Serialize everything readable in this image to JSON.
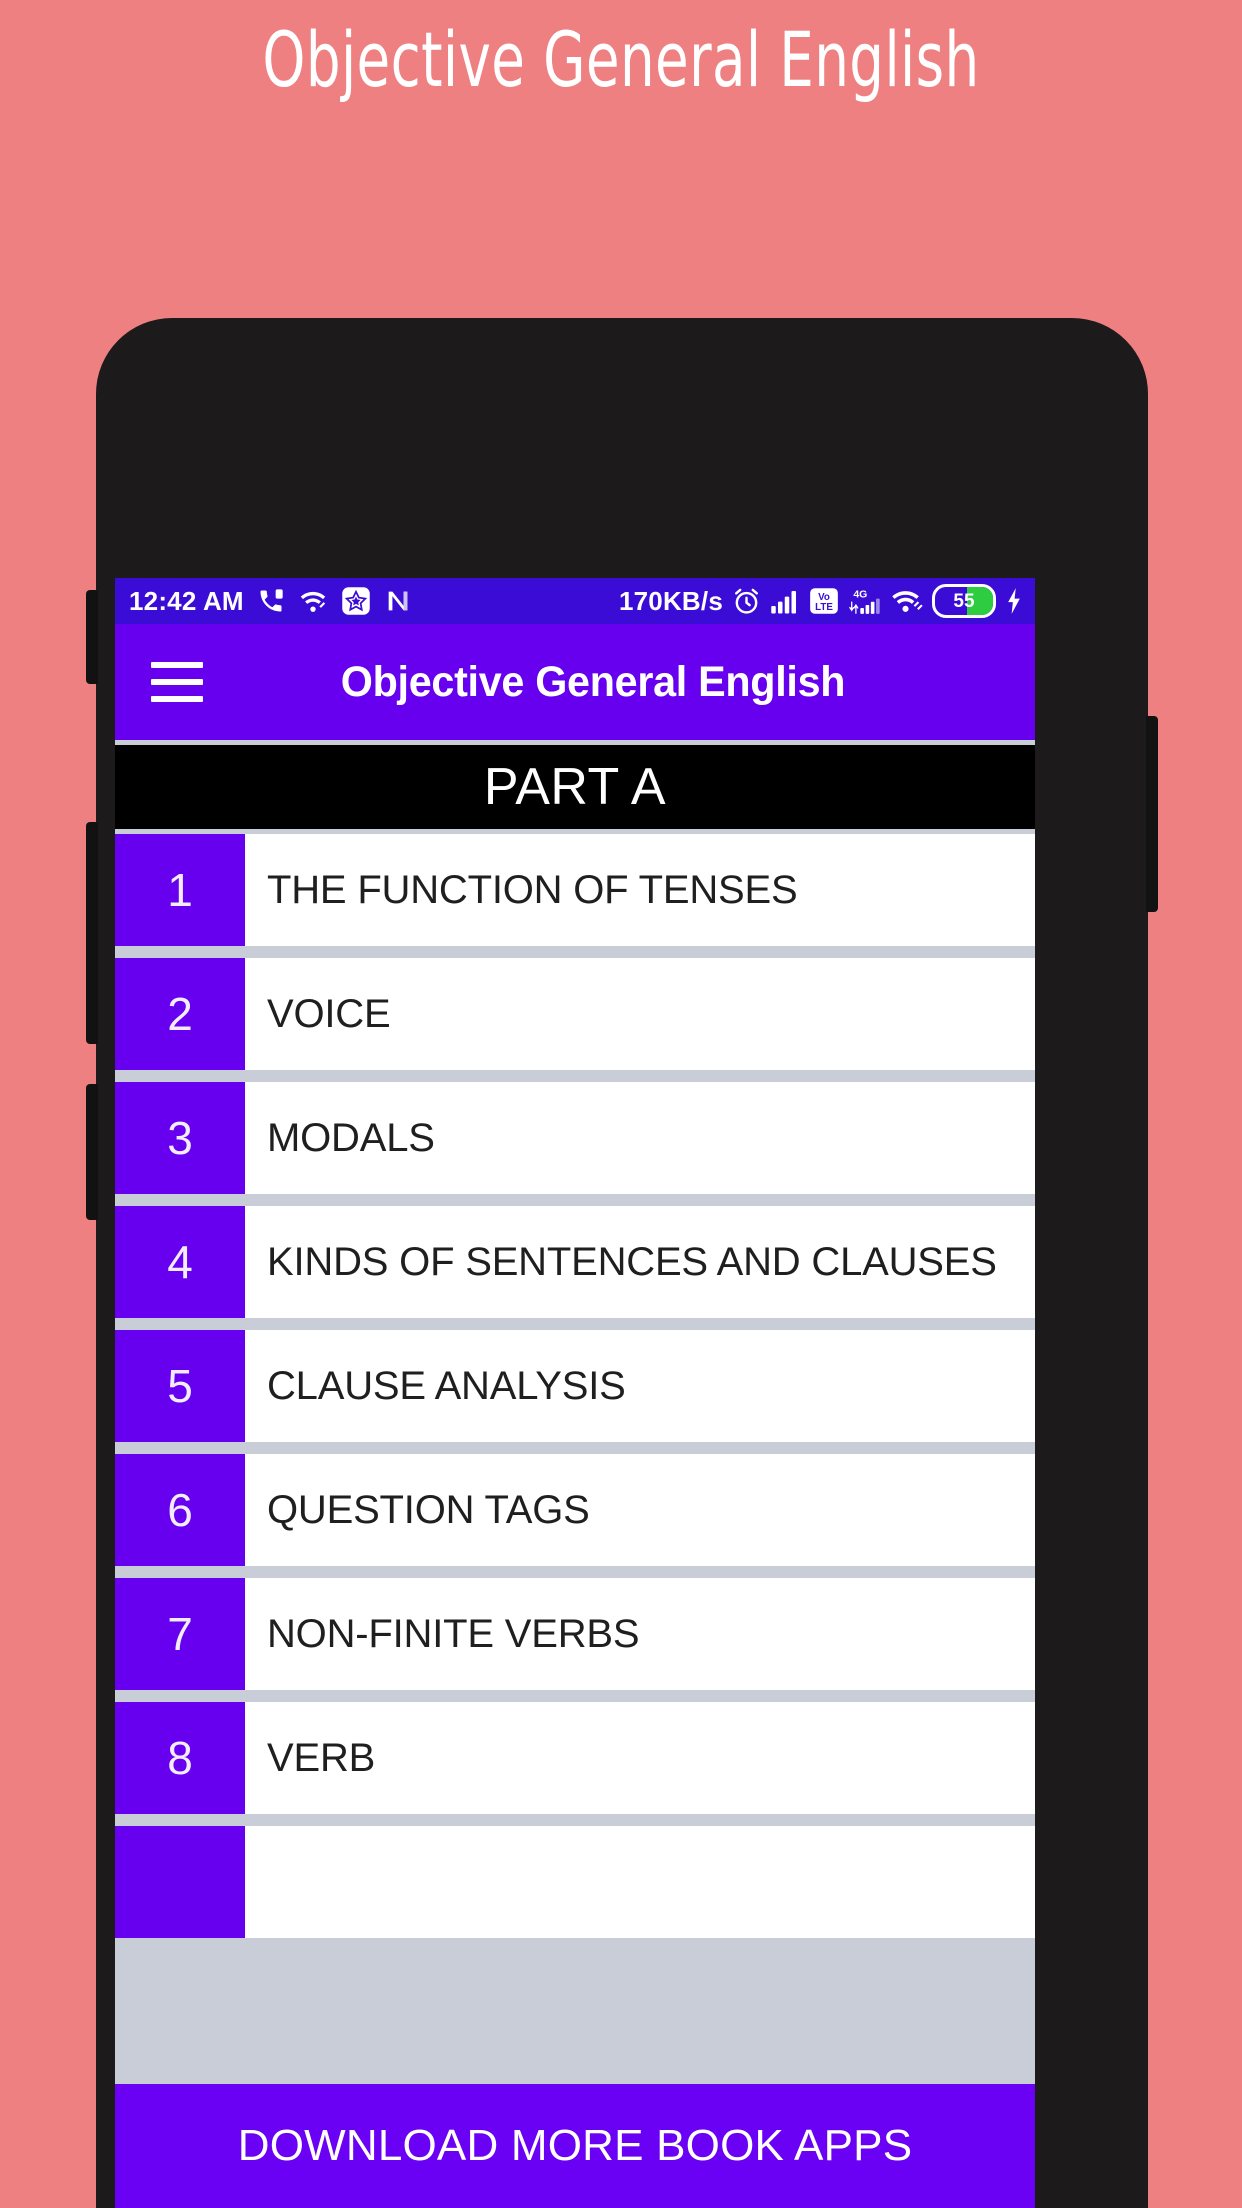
{
  "hero": {
    "title": "Objective General English"
  },
  "status_bar": {
    "time": "12:42 AM",
    "network_speed": "170KB/s",
    "battery_level": "55",
    "icons_left": [
      "missed-call-icon",
      "wifi-calling-icon",
      "star-app-icon",
      "nova-app-icon"
    ],
    "icons_right": [
      "alarm-icon",
      "signal-bars-icon",
      "volte-icon",
      "4g-signal-icon",
      "wifi-link-icon",
      "battery-icon",
      "charging-bolt-icon"
    ],
    "bg_color": "#3a0cd6"
  },
  "app_bar": {
    "menu_label": "Menu",
    "title": "Objective General English",
    "bg_color": "#6600ee"
  },
  "part_banner": {
    "label": "PART A",
    "bg_color": "#000000"
  },
  "chapters": [
    {
      "number": "1",
      "title": "THE FUNCTION OF TENSES"
    },
    {
      "number": "2",
      "title": "VOICE"
    },
    {
      "number": "3",
      "title": "MODALS"
    },
    {
      "number": "4",
      "title": "KINDS OF SENTENCES AND CLAUSES"
    },
    {
      "number": "5",
      "title": "CLAUSE ANALYSIS"
    },
    {
      "number": "6",
      "title": "QUESTION TAGS"
    },
    {
      "number": "7",
      "title": "NON-FINITE VERBS"
    },
    {
      "number": "8",
      "title": "VERB"
    },
    {
      "number": "",
      "title": ""
    }
  ],
  "download_bar": {
    "label": "DOWNLOAD MORE BOOK APPS",
    "bg_color": "#6a00f4"
  },
  "theme": {
    "page_background": "#ef8081",
    "accent_purple": "#6600ee",
    "divider": "#c8cdd8",
    "battery_green": "#2ecc40"
  }
}
